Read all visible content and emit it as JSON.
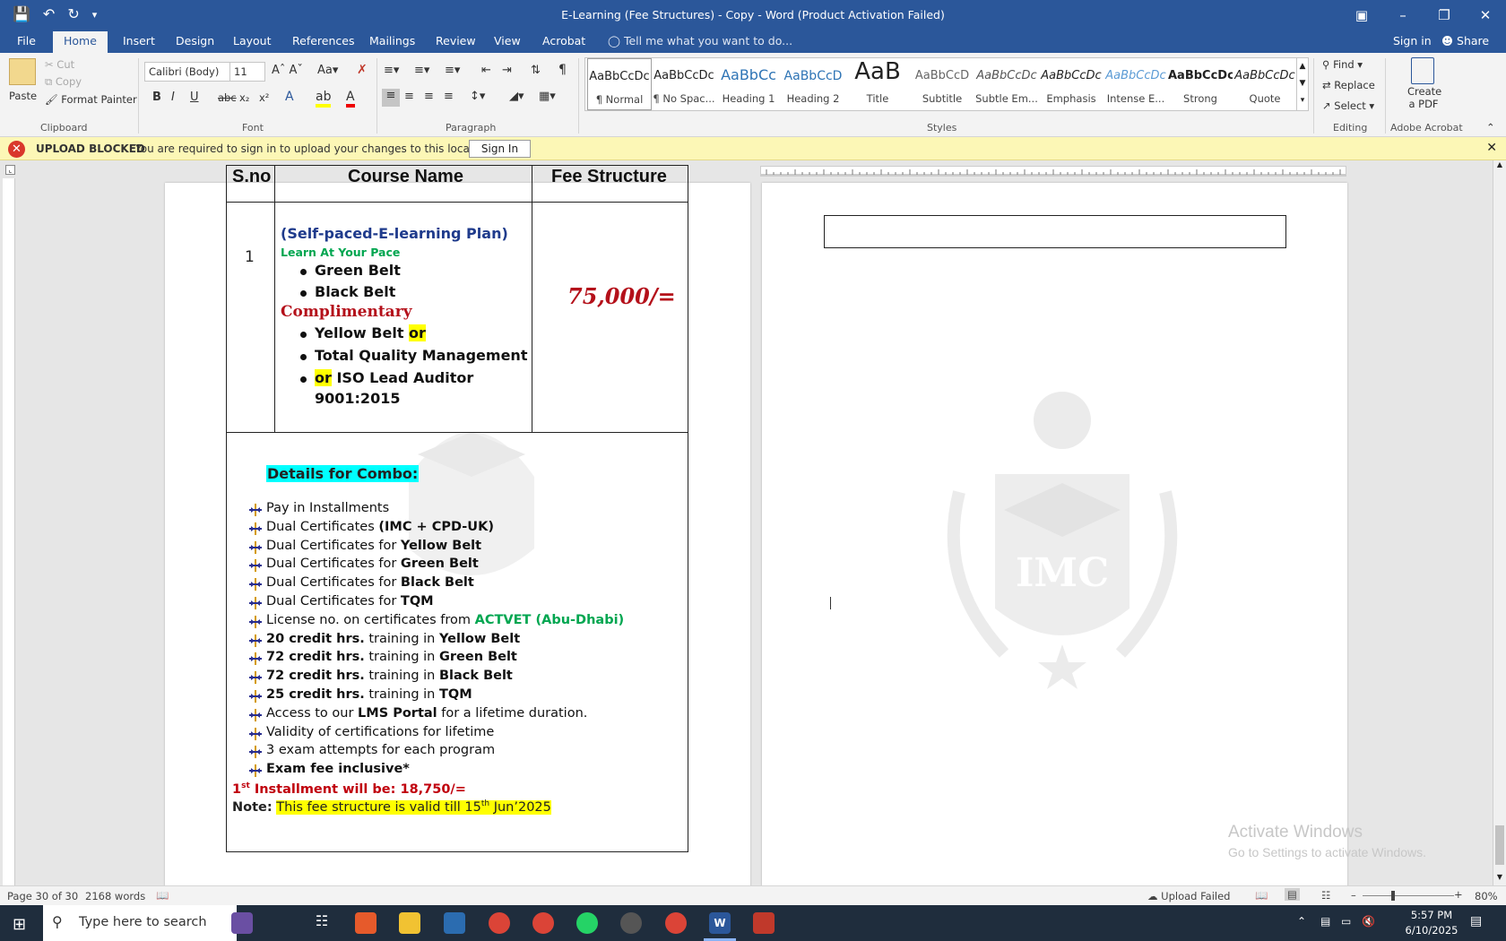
{
  "titlebar": {
    "title": "E-Learning (Fee Structures) - Copy - Word (Product Activation Failed)",
    "quick_access": [
      "save-icon",
      "undo-icon",
      "redo-icon",
      "customize-icon"
    ]
  },
  "tabs": [
    {
      "label": "File"
    },
    {
      "label": "Home"
    },
    {
      "label": "Insert"
    },
    {
      "label": "Design"
    },
    {
      "label": "Layout"
    },
    {
      "label": "References"
    },
    {
      "label": "Mailings"
    },
    {
      "label": "Review"
    },
    {
      "label": "View"
    },
    {
      "label": "Acrobat"
    }
  ],
  "tell_me": "Tell me what you want to do...",
  "sign_in": "Sign in",
  "share": "Share",
  "clipboard": {
    "paste": "Paste",
    "cut": "Cut",
    "copy": "Copy",
    "format_painter": "Format Painter",
    "label": "Clipboard"
  },
  "font": {
    "name": "Calibri (Body)",
    "size": "11",
    "label": "Font"
  },
  "paragraph": {
    "label": "Paragraph"
  },
  "styles": {
    "label": "Styles",
    "items": [
      {
        "preview": "AaBbCcDc",
        "name": "¶ Normal"
      },
      {
        "preview": "AaBbCcDc",
        "name": "¶ No Spac..."
      },
      {
        "preview": "AaBbCc",
        "name": "Heading 1"
      },
      {
        "preview": "AaBbCcD",
        "name": "Heading 2"
      },
      {
        "preview": "AaB",
        "name": "Title"
      },
      {
        "preview": "AaBbCcD",
        "name": "Subtitle"
      },
      {
        "preview": "AaBbCcDc",
        "name": "Subtle Em..."
      },
      {
        "preview": "AaBbCcDc",
        "name": "Emphasis"
      },
      {
        "preview": "AaBbCcDc",
        "name": "Intense E..."
      },
      {
        "preview": "AaBbCcDc",
        "name": "Strong"
      },
      {
        "preview": "AaBbCcDc",
        "name": "Quote"
      }
    ]
  },
  "editing": {
    "find": "Find",
    "replace": "Replace",
    "select": "Select",
    "label": "Editing"
  },
  "acrobat": {
    "create_pdf": "Create a PDF",
    "label": "Adobe Acrobat"
  },
  "message_bar": {
    "title": "UPLOAD BLOCKED",
    "text": "You are required to sign in to upload your changes to this location.",
    "button": "Sign In"
  },
  "document": {
    "headers": [
      "S.no",
      "Course Name",
      "Fee Structure"
    ],
    "row_no": "1",
    "plan": "(Self-paced-E-learning Plan)",
    "tagline": "Learn At Your Pace",
    "bullets1": [
      "Green Belt",
      "Black Belt"
    ],
    "complimentary": "Complimentary",
    "bullet_yellow": "Yellow Belt",
    "or": "or",
    "bullet_tqm": "Total Quality Management",
    "bullet_iso": "ISO Lead Auditor",
    "bullet_iso2": "9001:2015",
    "fee": "75,000/=",
    "combo_title": "Details for Combo:",
    "combo_items": [
      {
        "pre": "Pay in Installments",
        "bold": "",
        "post": ""
      },
      {
        "pre": "Dual Certificates ",
        "bold": "(IMC + CPD-UK)",
        "post": ""
      },
      {
        "pre": "Dual Certificates for ",
        "bold": "Yellow Belt",
        "post": ""
      },
      {
        "pre": "Dual Certificates for ",
        "bold": "Green Belt",
        "post": ""
      },
      {
        "pre": "Dual Certificates for ",
        "bold": "Black Belt",
        "post": ""
      },
      {
        "pre": "Dual Certificates for ",
        "bold": "TQM",
        "post": ""
      },
      {
        "pre": "License no. on certificates from ",
        "green": "ACTVET (Abu-Dhabi)"
      },
      {
        "bold1": "20 credit hrs.",
        "mid": " training in ",
        "bold": "Yellow Belt"
      },
      {
        "bold1": "72 credit hrs.",
        "mid": " training in ",
        "bold": "Green Belt"
      },
      {
        "bold1": "72 credit hrs.",
        "mid": " training in ",
        "bold": "Black Belt"
      },
      {
        "bold1": "25 credit hrs.",
        "mid": " training in ",
        "bold": "TQM"
      },
      {
        "pre": "Access to our ",
        "bold": "LMS Portal",
        "post": " for a lifetime duration."
      },
      {
        "pre": "Validity of certifications for lifetime",
        "bold": "",
        "post": ""
      },
      {
        "pre": "3 exam attempts for each program",
        "bold": "",
        "post": ""
      },
      {
        "pre": "",
        "bold": "Exam fee inclusive*",
        "post": ""
      }
    ],
    "installment_a": "1",
    "installment_sup": "st",
    "installment_b": " Installment will be: 18,750/=",
    "note_label": "Note:",
    "note_a": "This fee structure is valid till 15",
    "note_sup": "th",
    "note_b": " Jun’2025",
    "watermark": "IMC"
  },
  "activate": {
    "line1": "Activate Windows",
    "line2": "Go to Settings to activate Windows."
  },
  "status": {
    "page": "Page 30 of 30",
    "words": "2168 words",
    "upload": "Upload Failed",
    "zoom": "80%"
  },
  "taskbar": {
    "search": "Type here to search",
    "time": "5:57 PM",
    "date": "6/10/2025"
  }
}
